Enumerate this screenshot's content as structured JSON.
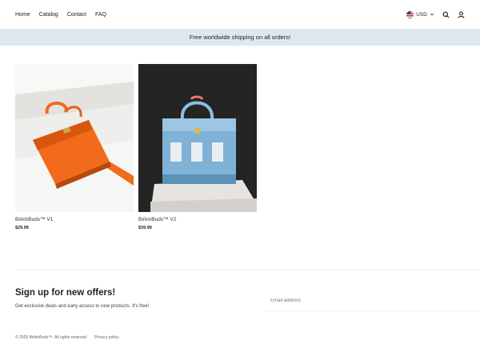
{
  "header": {
    "nav": [
      "Home",
      "Catalog",
      "Contact",
      "FAQ"
    ],
    "currency": "USD",
    "icons": [
      "us-flag-icon",
      "chevron-down-icon",
      "search-icon",
      "account-icon"
    ]
  },
  "announcement": "Free worldwide shipping on all orders!",
  "products": [
    {
      "title": "BirkinBuds™ V1",
      "price": "$29.99",
      "image": "orange bag on white background"
    },
    {
      "title": "BirkinBuds™ V2",
      "price": "$39.99",
      "image": "light blue bag on dark background"
    }
  ],
  "signup": {
    "title": "Sign up for new offers!",
    "text": "Get exclusive deals and early access to new products. It's free!",
    "email_placeholder": "Email address"
  },
  "footer": {
    "copyright": "© 2025 BirkinBuds™. All rights reserved",
    "privacy": "Privacy policy"
  },
  "colors": {
    "announcement_bg": "#dfe8ef",
    "bag_orange": "#f26a1b",
    "bag_blue": "#7fb2d6"
  }
}
